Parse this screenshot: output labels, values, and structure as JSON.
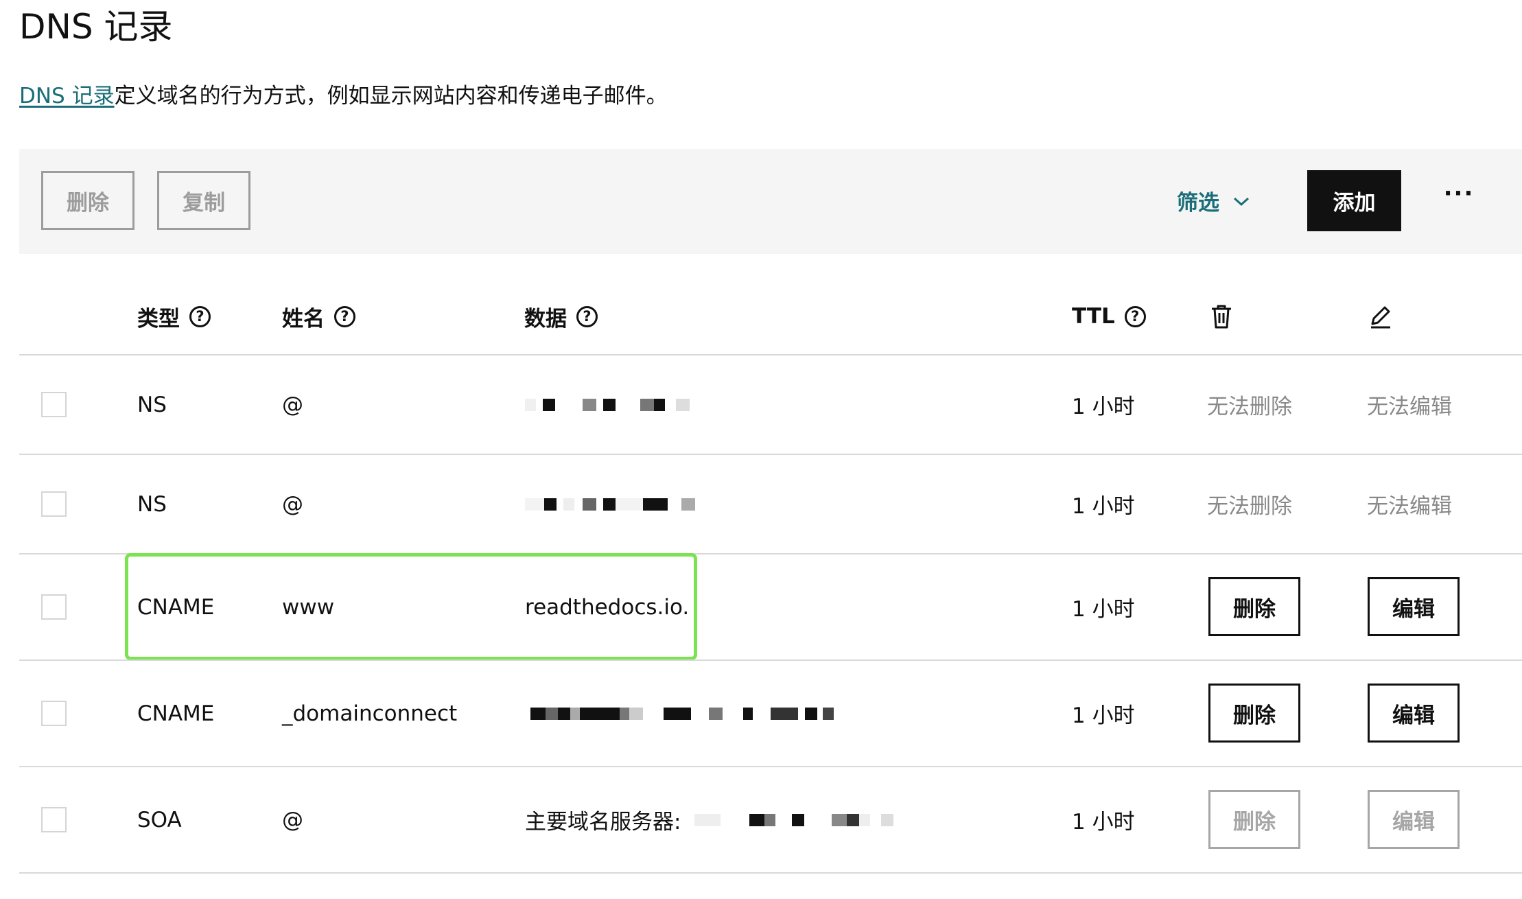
{
  "page": {
    "title": "DNS 记录",
    "description_link": "DNS 记录",
    "description_text": "定义域名的行为方式，例如显示网站内容和传递电子邮件。"
  },
  "toolbar": {
    "delete_label": "删除",
    "copy_label": "复制",
    "filter_label": "筛选",
    "add_label": "添加",
    "more_label": "···"
  },
  "table": {
    "headers": {
      "type": "类型",
      "name": "姓名",
      "data": "数据",
      "ttl": "TTL",
      "delete_icon": "trash-icon",
      "edit_icon": "pencil-icon"
    },
    "rows": [
      {
        "type": "NS",
        "name": "@",
        "data": "",
        "data_redacted": true,
        "ttl": "1 小时",
        "delete": "无法删除",
        "edit": "无法编辑",
        "actions": "text"
      },
      {
        "type": "NS",
        "name": "@",
        "data": "",
        "data_redacted": true,
        "ttl": "1 小时",
        "delete": "无法删除",
        "edit": "无法编辑",
        "actions": "text"
      },
      {
        "type": "CNAME",
        "name": "www",
        "data": "readthedocs.io.",
        "data_redacted": false,
        "ttl": "1 小时",
        "delete": "删除",
        "edit": "编辑",
        "actions": "buttons"
      },
      {
        "type": "CNAME",
        "name": "_domainconnect",
        "data": "",
        "data_redacted": true,
        "ttl": "1 小时",
        "delete": "删除",
        "edit": "编辑",
        "actions": "buttons"
      },
      {
        "type": "SOA",
        "name": "@",
        "data": "主要域名服务器:",
        "data_redacted": true,
        "ttl": "1 小时",
        "delete": "删除",
        "edit": "编辑",
        "actions": "disabled-buttons"
      }
    ]
  },
  "colors": {
    "link": "#1b6e78",
    "highlight": "#7be34f",
    "add_button_bg": "#111111"
  }
}
